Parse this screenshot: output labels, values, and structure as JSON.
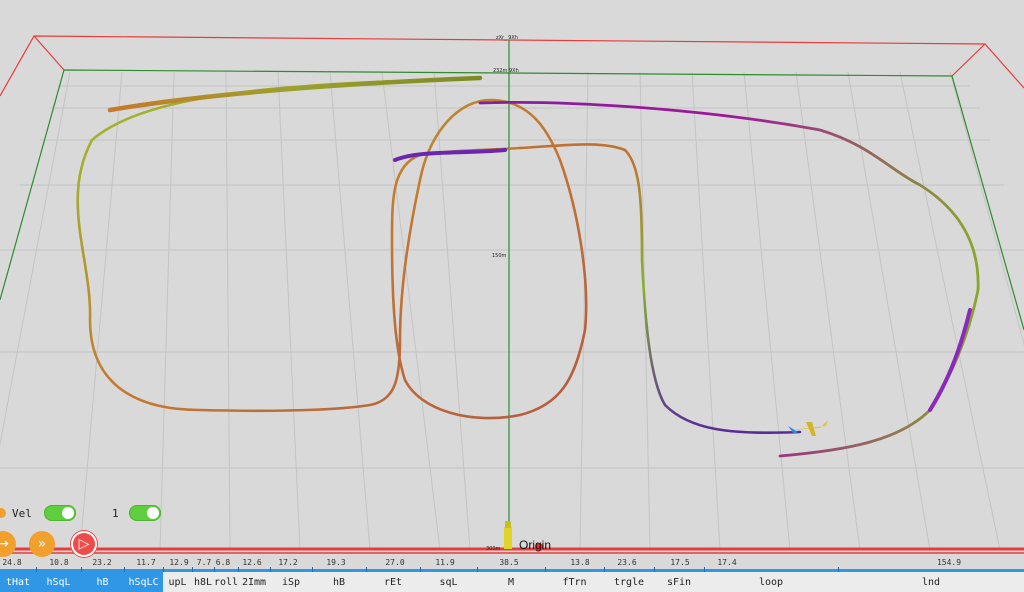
{
  "scene": {
    "axis_labels": [
      "zXr_ 9Xh",
      "232m 9Xh",
      "150m",
      "300m"
    ],
    "origin_label": "Origin"
  },
  "controls": {
    "vel_label": "Vel",
    "vel_toggle_on": true,
    "second_label": "1",
    "second_toggle_on": true,
    "buttons": [
      {
        "name": "forward-button",
        "icon": "arrow-right-icon",
        "glyph": "→",
        "color": "#f2a02d"
      },
      {
        "name": "fast-forward-button",
        "icon": "fast-forward-icon",
        "glyph": "»",
        "color": "#f2a02d"
      },
      {
        "name": "play-button",
        "icon": "play-icon",
        "glyph": "▷",
        "color": "#ef4b4b"
      }
    ]
  },
  "timeline": {
    "ticks": [
      "24.8",
      "10.8",
      "23.2",
      "11.7",
      "12.9",
      "7.7",
      "6.8",
      "12.6",
      "17.2",
      "19.3",
      "27.0",
      "11.9",
      "38.5",
      "13.8",
      "23.6",
      "17.5",
      "17.4",
      "154.9"
    ],
    "segments": [
      {
        "label": "tHat",
        "active": true
      },
      {
        "label": "hSqL",
        "active": true
      },
      {
        "label": "hB",
        "active": true
      },
      {
        "label": "hSqLC",
        "active": true
      },
      {
        "label": "upL",
        "active": false
      },
      {
        "label": "h8L",
        "active": false
      },
      {
        "label": "roll",
        "active": false
      },
      {
        "label": "2Imm",
        "active": false
      },
      {
        "label": "iSp",
        "active": false
      },
      {
        "label": "hB",
        "active": false
      },
      {
        "label": "rEt",
        "active": false
      },
      {
        "label": "sqL",
        "active": false
      },
      {
        "label": "M",
        "active": false
      },
      {
        "label": "fTrn",
        "active": false
      },
      {
        "label": "trgle",
        "active": false
      },
      {
        "label": "sFin",
        "active": false
      },
      {
        "label": "loop",
        "active": false
      },
      {
        "label": "lnd",
        "active": false
      }
    ]
  },
  "colors": {
    "accent": "#2f97e6",
    "red_box": "#e83b3b",
    "green_box": "#2e8b2e",
    "toggle_on": "#5fce3f",
    "button_orange": "#f2a02d",
    "button_red": "#ef4b4b"
  }
}
